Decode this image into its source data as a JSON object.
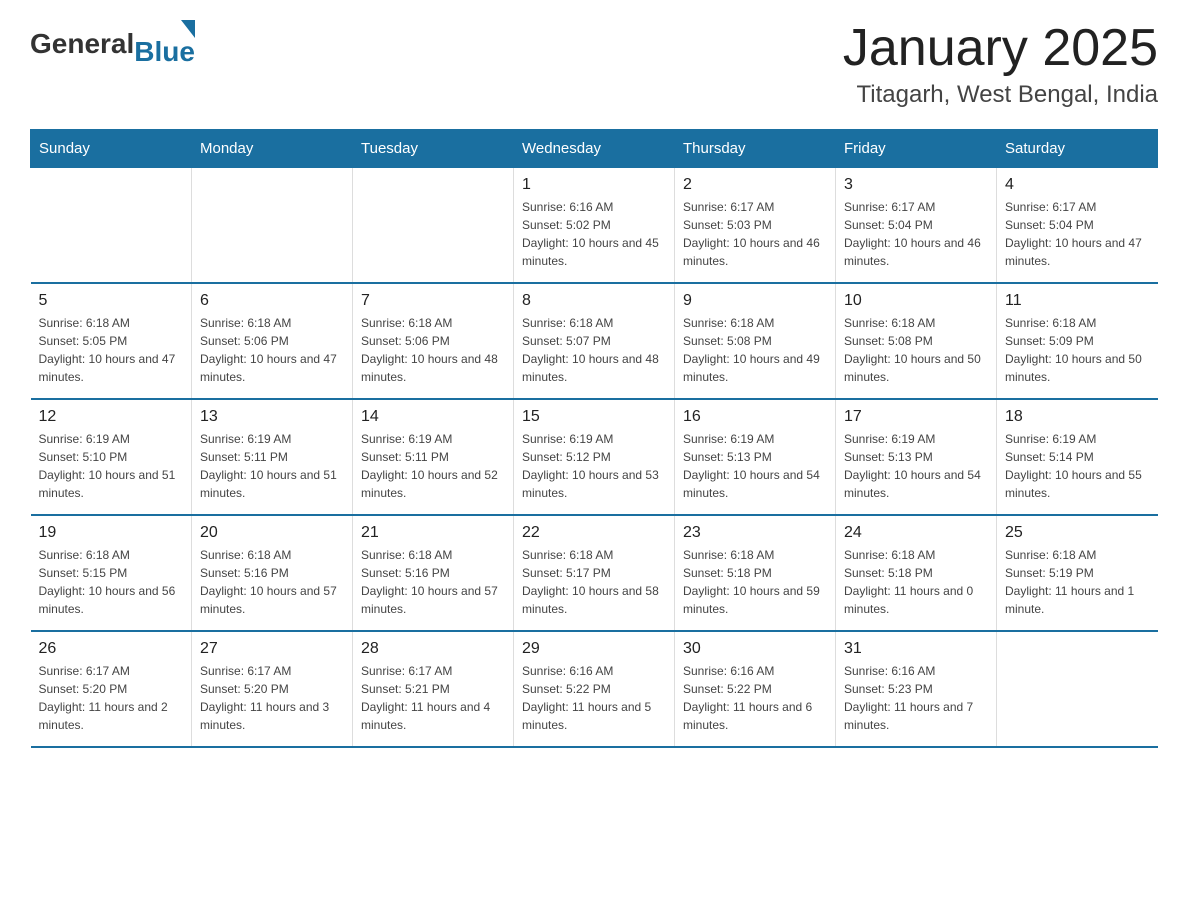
{
  "header": {
    "logo": {
      "general": "General",
      "blue": "Blue",
      "arrow": "▲"
    },
    "title": "January 2025",
    "location": "Titagarh, West Bengal, India"
  },
  "calendar": {
    "days_of_week": [
      "Sunday",
      "Monday",
      "Tuesday",
      "Wednesday",
      "Thursday",
      "Friday",
      "Saturday"
    ],
    "weeks": [
      [
        {
          "day": "",
          "sunrise": "",
          "sunset": "",
          "daylight": ""
        },
        {
          "day": "",
          "sunrise": "",
          "sunset": "",
          "daylight": ""
        },
        {
          "day": "",
          "sunrise": "",
          "sunset": "",
          "daylight": ""
        },
        {
          "day": "1",
          "sunrise": "Sunrise: 6:16 AM",
          "sunset": "Sunset: 5:02 PM",
          "daylight": "Daylight: 10 hours and 45 minutes."
        },
        {
          "day": "2",
          "sunrise": "Sunrise: 6:17 AM",
          "sunset": "Sunset: 5:03 PM",
          "daylight": "Daylight: 10 hours and 46 minutes."
        },
        {
          "day": "3",
          "sunrise": "Sunrise: 6:17 AM",
          "sunset": "Sunset: 5:04 PM",
          "daylight": "Daylight: 10 hours and 46 minutes."
        },
        {
          "day": "4",
          "sunrise": "Sunrise: 6:17 AM",
          "sunset": "Sunset: 5:04 PM",
          "daylight": "Daylight: 10 hours and 47 minutes."
        }
      ],
      [
        {
          "day": "5",
          "sunrise": "Sunrise: 6:18 AM",
          "sunset": "Sunset: 5:05 PM",
          "daylight": "Daylight: 10 hours and 47 minutes."
        },
        {
          "day": "6",
          "sunrise": "Sunrise: 6:18 AM",
          "sunset": "Sunset: 5:06 PM",
          "daylight": "Daylight: 10 hours and 47 minutes."
        },
        {
          "day": "7",
          "sunrise": "Sunrise: 6:18 AM",
          "sunset": "Sunset: 5:06 PM",
          "daylight": "Daylight: 10 hours and 48 minutes."
        },
        {
          "day": "8",
          "sunrise": "Sunrise: 6:18 AM",
          "sunset": "Sunset: 5:07 PM",
          "daylight": "Daylight: 10 hours and 48 minutes."
        },
        {
          "day": "9",
          "sunrise": "Sunrise: 6:18 AM",
          "sunset": "Sunset: 5:08 PM",
          "daylight": "Daylight: 10 hours and 49 minutes."
        },
        {
          "day": "10",
          "sunrise": "Sunrise: 6:18 AM",
          "sunset": "Sunset: 5:08 PM",
          "daylight": "Daylight: 10 hours and 50 minutes."
        },
        {
          "day": "11",
          "sunrise": "Sunrise: 6:18 AM",
          "sunset": "Sunset: 5:09 PM",
          "daylight": "Daylight: 10 hours and 50 minutes."
        }
      ],
      [
        {
          "day": "12",
          "sunrise": "Sunrise: 6:19 AM",
          "sunset": "Sunset: 5:10 PM",
          "daylight": "Daylight: 10 hours and 51 minutes."
        },
        {
          "day": "13",
          "sunrise": "Sunrise: 6:19 AM",
          "sunset": "Sunset: 5:11 PM",
          "daylight": "Daylight: 10 hours and 51 minutes."
        },
        {
          "day": "14",
          "sunrise": "Sunrise: 6:19 AM",
          "sunset": "Sunset: 5:11 PM",
          "daylight": "Daylight: 10 hours and 52 minutes."
        },
        {
          "day": "15",
          "sunrise": "Sunrise: 6:19 AM",
          "sunset": "Sunset: 5:12 PM",
          "daylight": "Daylight: 10 hours and 53 minutes."
        },
        {
          "day": "16",
          "sunrise": "Sunrise: 6:19 AM",
          "sunset": "Sunset: 5:13 PM",
          "daylight": "Daylight: 10 hours and 54 minutes."
        },
        {
          "day": "17",
          "sunrise": "Sunrise: 6:19 AM",
          "sunset": "Sunset: 5:13 PM",
          "daylight": "Daylight: 10 hours and 54 minutes."
        },
        {
          "day": "18",
          "sunrise": "Sunrise: 6:19 AM",
          "sunset": "Sunset: 5:14 PM",
          "daylight": "Daylight: 10 hours and 55 minutes."
        }
      ],
      [
        {
          "day": "19",
          "sunrise": "Sunrise: 6:18 AM",
          "sunset": "Sunset: 5:15 PM",
          "daylight": "Daylight: 10 hours and 56 minutes."
        },
        {
          "day": "20",
          "sunrise": "Sunrise: 6:18 AM",
          "sunset": "Sunset: 5:16 PM",
          "daylight": "Daylight: 10 hours and 57 minutes."
        },
        {
          "day": "21",
          "sunrise": "Sunrise: 6:18 AM",
          "sunset": "Sunset: 5:16 PM",
          "daylight": "Daylight: 10 hours and 57 minutes."
        },
        {
          "day": "22",
          "sunrise": "Sunrise: 6:18 AM",
          "sunset": "Sunset: 5:17 PM",
          "daylight": "Daylight: 10 hours and 58 minutes."
        },
        {
          "day": "23",
          "sunrise": "Sunrise: 6:18 AM",
          "sunset": "Sunset: 5:18 PM",
          "daylight": "Daylight: 10 hours and 59 minutes."
        },
        {
          "day": "24",
          "sunrise": "Sunrise: 6:18 AM",
          "sunset": "Sunset: 5:18 PM",
          "daylight": "Daylight: 11 hours and 0 minutes."
        },
        {
          "day": "25",
          "sunrise": "Sunrise: 6:18 AM",
          "sunset": "Sunset: 5:19 PM",
          "daylight": "Daylight: 11 hours and 1 minute."
        }
      ],
      [
        {
          "day": "26",
          "sunrise": "Sunrise: 6:17 AM",
          "sunset": "Sunset: 5:20 PM",
          "daylight": "Daylight: 11 hours and 2 minutes."
        },
        {
          "day": "27",
          "sunrise": "Sunrise: 6:17 AM",
          "sunset": "Sunset: 5:20 PM",
          "daylight": "Daylight: 11 hours and 3 minutes."
        },
        {
          "day": "28",
          "sunrise": "Sunrise: 6:17 AM",
          "sunset": "Sunset: 5:21 PM",
          "daylight": "Daylight: 11 hours and 4 minutes."
        },
        {
          "day": "29",
          "sunrise": "Sunrise: 6:16 AM",
          "sunset": "Sunset: 5:22 PM",
          "daylight": "Daylight: 11 hours and 5 minutes."
        },
        {
          "day": "30",
          "sunrise": "Sunrise: 6:16 AM",
          "sunset": "Sunset: 5:22 PM",
          "daylight": "Daylight: 11 hours and 6 minutes."
        },
        {
          "day": "31",
          "sunrise": "Sunrise: 6:16 AM",
          "sunset": "Sunset: 5:23 PM",
          "daylight": "Daylight: 11 hours and 7 minutes."
        },
        {
          "day": "",
          "sunrise": "",
          "sunset": "",
          "daylight": ""
        }
      ]
    ]
  }
}
